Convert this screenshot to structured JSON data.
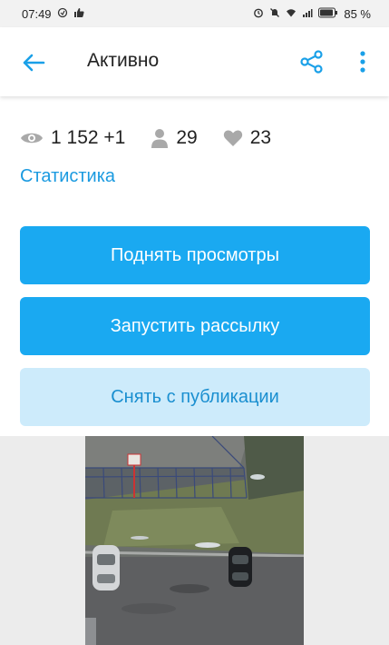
{
  "status": {
    "time": "07:49",
    "battery": "85 %"
  },
  "appbar": {
    "title": "Активно",
    "icons": [
      "back-arrow-icon",
      "share-icon",
      "more-vertical-icon"
    ]
  },
  "stats": {
    "views": "1 152 +1",
    "visitors": "29",
    "likes": "23",
    "link": "Статистика"
  },
  "actions": {
    "raise_views": "Поднять просмотры",
    "start_mailing": "Запустить рассылку",
    "unpublish": "Снять с публикации"
  },
  "colors": {
    "primary": "#1aa9f1",
    "primary_light": "#cdebfb",
    "link": "#1a9ae0"
  }
}
